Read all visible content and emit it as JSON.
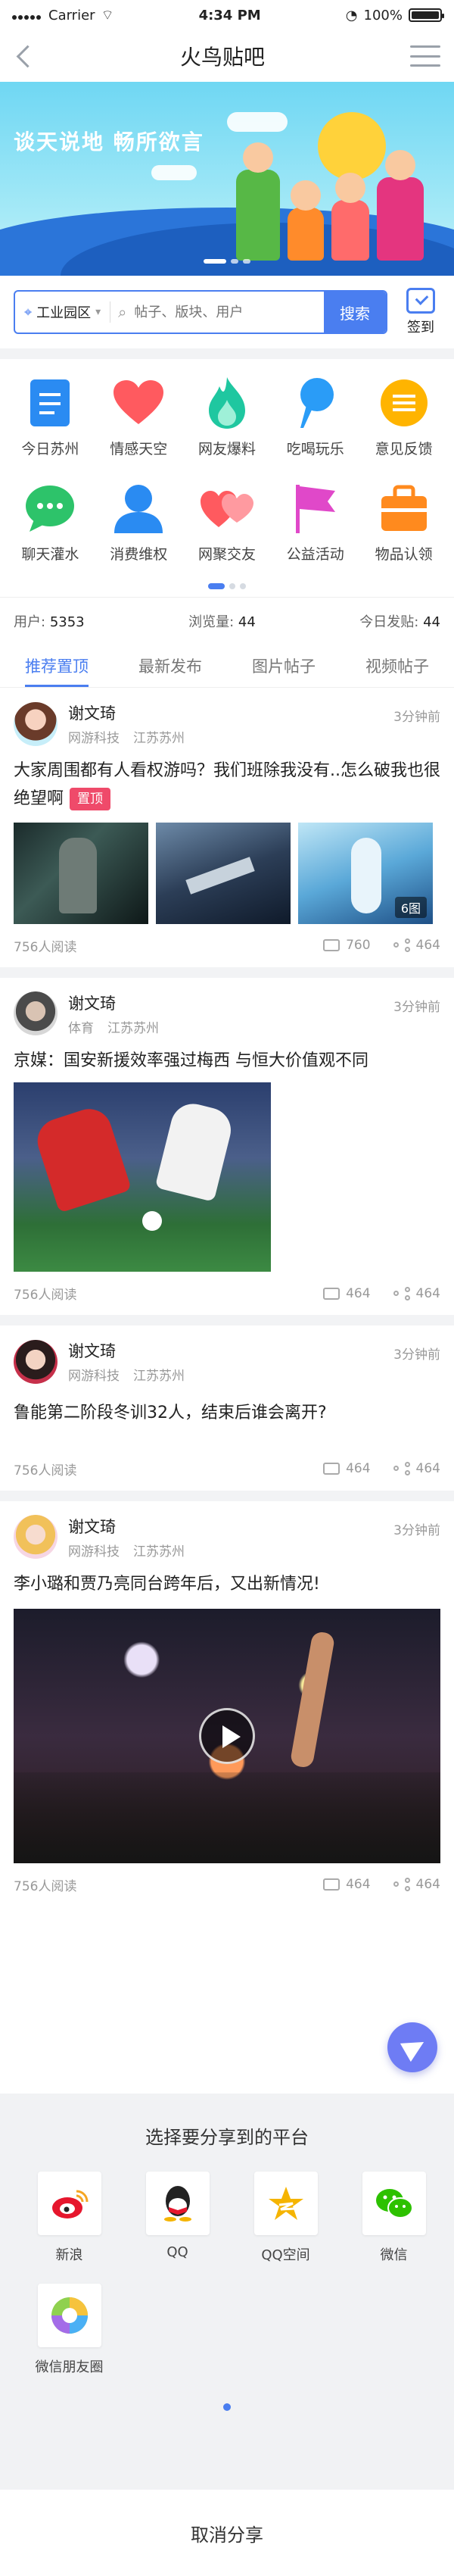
{
  "status_bar": {
    "carrier": "Carrier",
    "time": "4:34 PM",
    "battery": "100%"
  },
  "nav": {
    "title": "火鸟贴吧"
  },
  "banner": {
    "slogan": "谈天说地  畅所欲言"
  },
  "search": {
    "location": "工业园区",
    "placeholder": "帖子、版块、用户",
    "button": "搜索",
    "signin": "签到"
  },
  "categories": [
    {
      "label": "今日苏州",
      "icon": "document-icon",
      "color": "#2a8bf2"
    },
    {
      "label": "情感天空",
      "icon": "heart-icon",
      "color": "#ff5a5f"
    },
    {
      "label": "网友爆料",
      "icon": "flame-icon",
      "color": "#1fc7a0"
    },
    {
      "label": "吃喝玩乐",
      "icon": "ice-cream-icon",
      "color": "#2a9cf7"
    },
    {
      "label": "意见反馈",
      "icon": "list-icon",
      "color": "#ffb400"
    },
    {
      "label": "聊天灌水",
      "icon": "chat-icon",
      "color": "#2dc36a"
    },
    {
      "label": "消费维权",
      "icon": "person-icon",
      "color": "#2a8bf2"
    },
    {
      "label": "网聚交友",
      "icon": "hearts-icon",
      "color": "#ff5a5f"
    },
    {
      "label": "公益活动",
      "icon": "flag-icon",
      "color": "#e048c9"
    },
    {
      "label": "物品认领",
      "icon": "bag-icon",
      "color": "#ff8a1e"
    }
  ],
  "stats": {
    "users_label": "用户:",
    "users": "5353",
    "views_label": "浏览量:",
    "views": "44",
    "today_label": "今日发贴:",
    "today": "44"
  },
  "tabs": [
    "推荐置顶",
    "最新发布",
    "图片帖子",
    "视频帖子"
  ],
  "posts": [
    {
      "author": "谢文琦",
      "org": "网游科技",
      "location": "江苏苏州",
      "time": "3分钟前",
      "title": "大家周围都有人看权游吗？我们班除我没有..怎么破我也很绝望啊",
      "badge": "置顶",
      "image_count": "6图",
      "reads": "756人阅读",
      "comments": "760",
      "shares": "464"
    },
    {
      "author": "谢文琦",
      "org": "体育",
      "location": "江苏苏州",
      "time": "3分钟前",
      "title": "京媒：国安新援效率强过梅西 与恒大价值观不同",
      "reads": "756人阅读",
      "comments": "464",
      "shares": "464"
    },
    {
      "author": "谢文琦",
      "org": "网游科技",
      "location": "江苏苏州",
      "time": "3分钟前",
      "title": "鲁能第二阶段冬训32人，结束后谁会离开?",
      "reads": "756人阅读",
      "comments": "464",
      "shares": "464"
    },
    {
      "author": "谢文琦",
      "org": "网游科技",
      "location": "江苏苏州",
      "time": "3分钟前",
      "title": "李小璐和贾乃亮同台跨年后，又出新情况!",
      "reads": "756人阅读",
      "comments": "464",
      "shares": "464"
    }
  ],
  "share_sheet": {
    "title": "选择要分享到的平台",
    "items": [
      {
        "label": "新浪",
        "icon": "weibo-icon",
        "color": "#e6162d"
      },
      {
        "label": "QQ",
        "icon": "qq-icon",
        "color": "#222222"
      },
      {
        "label": "QQ空间",
        "icon": "qzone-icon",
        "color": "#f5b400"
      },
      {
        "label": "微信",
        "icon": "wechat-icon",
        "color": "#2dc100"
      },
      {
        "label": "微信朋友圈",
        "icon": "moments-icon",
        "color": "#8fd14f"
      }
    ],
    "cancel": "取消分享"
  }
}
